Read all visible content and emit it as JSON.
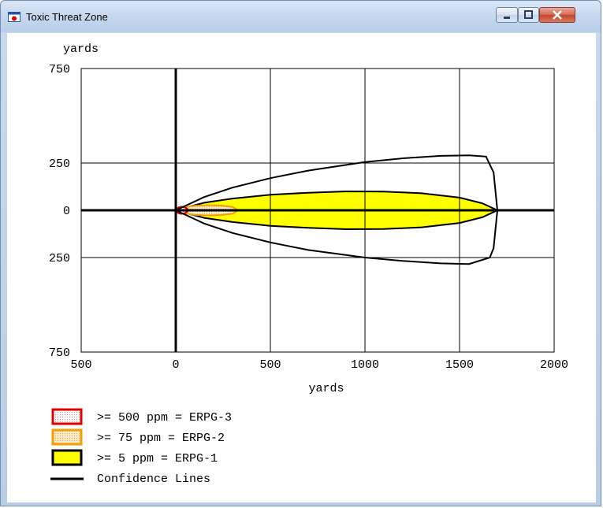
{
  "window": {
    "title": "Toxic Threat Zone",
    "icons": [
      "app-icon",
      "minimize-icon",
      "maximize-icon",
      "close-icon"
    ]
  },
  "chart_data": {
    "type": "area",
    "xlabel": "yards",
    "ylabel": "yards",
    "xlim": [
      -500,
      2000
    ],
    "ylim": [
      -750,
      750
    ],
    "x_ticks": [
      -500,
      0,
      500,
      1000,
      1500,
      2000
    ],
    "x_tick_labels": [
      "500",
      "0",
      "500",
      "1000",
      "1500",
      "2000"
    ],
    "y_ticks": [
      750,
      250,
      0,
      -250,
      -750
    ],
    "y_tick_labels": [
      "750",
      "250",
      "0",
      "250",
      "750"
    ],
    "grid": true,
    "series": [
      {
        "name": ">= 500 ppm = ERPG-3",
        "kind": "zone",
        "fill": "#fff0f0",
        "stroke": "#e00000",
        "points": [
          [
            0,
            0
          ],
          [
            5,
            9
          ],
          [
            15,
            16
          ],
          [
            30,
            19
          ],
          [
            45,
            16
          ],
          [
            60,
            9
          ],
          [
            65,
            0
          ],
          [
            60,
            -9
          ],
          [
            45,
            -16
          ],
          [
            30,
            -19
          ],
          [
            15,
            -16
          ],
          [
            5,
            -9
          ],
          [
            0,
            0
          ]
        ]
      },
      {
        "name": ">= 75 ppm = ERPG-2",
        "kind": "zone",
        "fill": "#fde2b6",
        "stroke": "#f0a000",
        "points": [
          [
            0,
            0
          ],
          [
            40,
            16
          ],
          [
            100,
            24
          ],
          [
            170,
            27
          ],
          [
            240,
            25
          ],
          [
            300,
            18
          ],
          [
            330,
            0
          ],
          [
            300,
            -18
          ],
          [
            240,
            -25
          ],
          [
            170,
            -27
          ],
          [
            100,
            -24
          ],
          [
            40,
            -16
          ],
          [
            0,
            0
          ]
        ]
      },
      {
        "name": ">= 5 ppm = ERPG-1",
        "kind": "zone",
        "fill": "#ffff00",
        "stroke": "#000000",
        "points": [
          [
            0,
            0
          ],
          [
            150,
            40
          ],
          [
            300,
            62
          ],
          [
            500,
            82
          ],
          [
            700,
            93
          ],
          [
            900,
            100
          ],
          [
            1100,
            99
          ],
          [
            1300,
            90
          ],
          [
            1500,
            67
          ],
          [
            1620,
            37
          ],
          [
            1700,
            0
          ],
          [
            1620,
            -37
          ],
          [
            1500,
            -67
          ],
          [
            1300,
            -90
          ],
          [
            1100,
            -99
          ],
          [
            900,
            -100
          ],
          [
            700,
            -93
          ],
          [
            500,
            -82
          ],
          [
            300,
            -62
          ],
          [
            150,
            -40
          ],
          [
            0,
            0
          ]
        ]
      },
      {
        "name": "Confidence Lines",
        "kind": "line",
        "stroke": "#000000",
        "points": [
          [
            0,
            0
          ],
          [
            150,
            70
          ],
          [
            300,
            120
          ],
          [
            500,
            170
          ],
          [
            700,
            210
          ],
          [
            1000,
            255
          ],
          [
            1200,
            275
          ],
          [
            1400,
            288
          ],
          [
            1550,
            291
          ],
          [
            1640,
            284
          ],
          [
            1680,
            200
          ],
          [
            1700,
            0
          ],
          [
            1680,
            -200
          ],
          [
            1660,
            -250
          ],
          [
            1550,
            -284
          ],
          [
            1400,
            -281
          ],
          [
            1200,
            -268
          ],
          [
            1000,
            -250
          ],
          [
            700,
            -210
          ],
          [
            500,
            -170
          ],
          [
            300,
            -120
          ],
          [
            150,
            -70
          ],
          [
            0,
            0
          ]
        ]
      }
    ],
    "legend": {
      "placement": "bottom-left",
      "items": [
        {
          "label": ">= 500 ppm = ERPG-3",
          "swatch": "dotted-red"
        },
        {
          "label": ">= 75 ppm = ERPG-2",
          "swatch": "dotted-orange"
        },
        {
          "label": ">= 5 ppm = ERPG-1",
          "swatch": "yellow-black"
        },
        {
          "label": "Confidence Lines",
          "swatch": "black-line"
        }
      ]
    }
  }
}
